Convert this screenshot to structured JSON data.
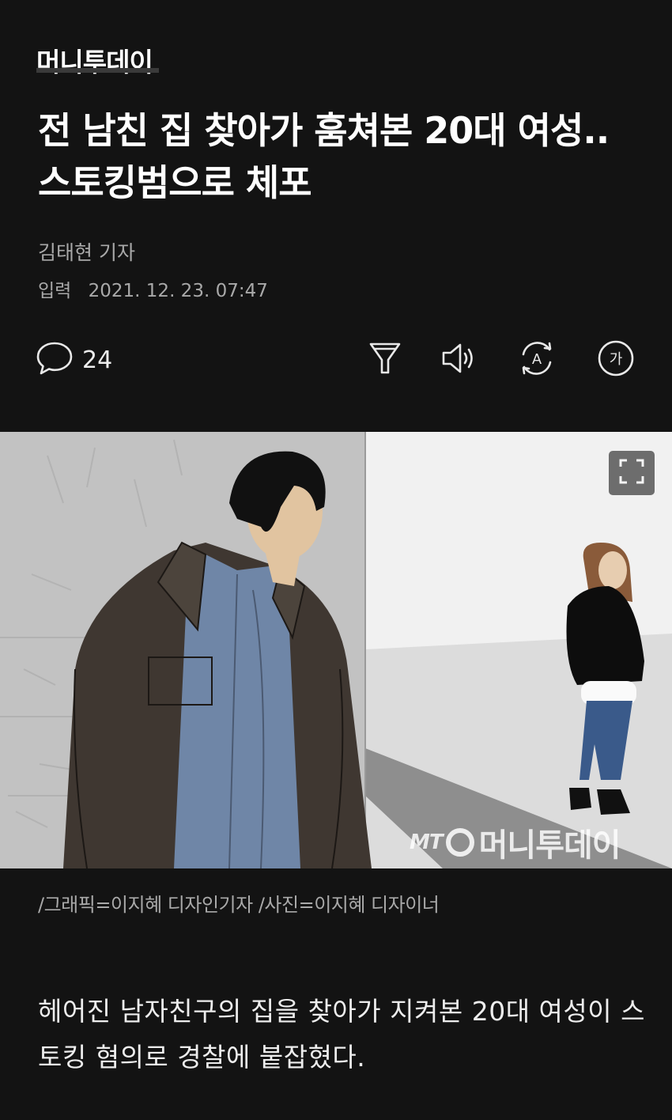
{
  "header": {
    "press_name": "머니투데이"
  },
  "article": {
    "headline": "전 남친 집 찾아가 훔쳐본 20대 여성..스토킹범으로 체포",
    "reporter": "김태현 기자",
    "published_label": "입력",
    "published_time": "2021. 12. 23. 07:47"
  },
  "toolbar": {
    "comment_count": "24",
    "icons": [
      "comment-icon",
      "filter-icon",
      "speaker-icon",
      "translate-icon",
      "font-size-icon"
    ],
    "font_size_glyph": "가",
    "translate_glyph": "A"
  },
  "hero_image": {
    "watermark_mt": "MT",
    "watermark_text": "머니투데이",
    "expand_icon": "expand-icon"
  },
  "caption": "/그래픽=이지혜 디자인기자 /사진=이지혜 디자이너",
  "body": "헤어진 남자친구의 집을 찾아가 지켜본 20대 여성이 스토킹 혐의로 경찰에 붙잡혔다.",
  "colors": {
    "background": "#131313",
    "text_primary": "#ffffff",
    "text_secondary": "#a9a9a9"
  }
}
